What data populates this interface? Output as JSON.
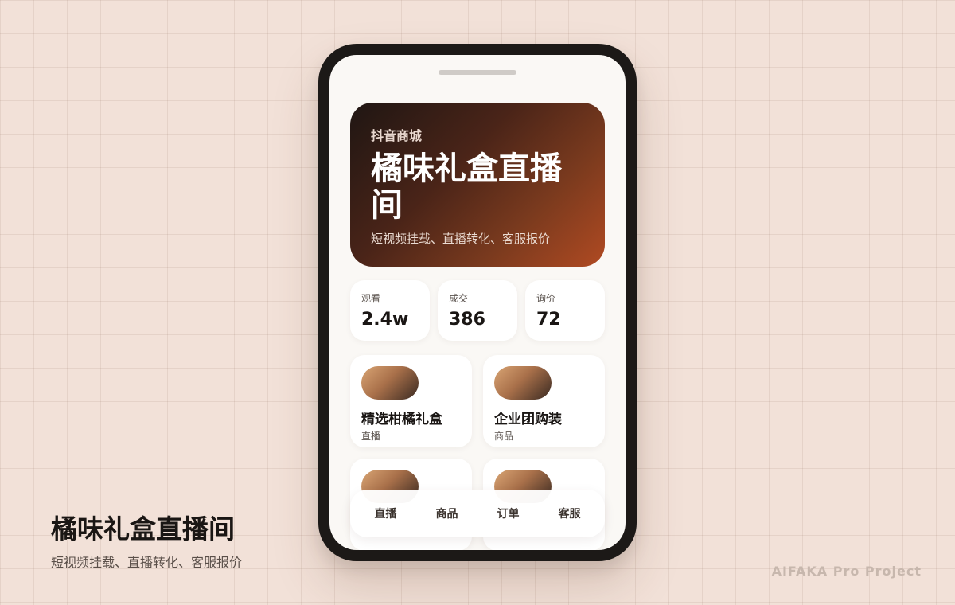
{
  "phone": {
    "hero": {
      "eyebrow": "抖音商城",
      "title": "橘味礼盒直播间",
      "subtitle": "短视频挂载、直播转化、客服报价"
    },
    "stats": [
      {
        "label": "观看",
        "value": "2.4w"
      },
      {
        "label": "成交",
        "value": "386"
      },
      {
        "label": "询价",
        "value": "72"
      }
    ],
    "products": [
      {
        "title": "精选柑橘礼盒",
        "tag": "直播"
      },
      {
        "title": "企业团购装",
        "tag": "商品"
      },
      {
        "title": "",
        "tag": ""
      },
      {
        "title": "",
        "tag": ""
      }
    ],
    "nav": [
      "直播",
      "商品",
      "订单",
      "客服"
    ]
  },
  "caption": {
    "title": "橘味礼盒直播间",
    "subtitle": "短视频挂载、直播转化、客服报价"
  },
  "footer": {
    "brand": "AIFAKA Pro Project"
  }
}
